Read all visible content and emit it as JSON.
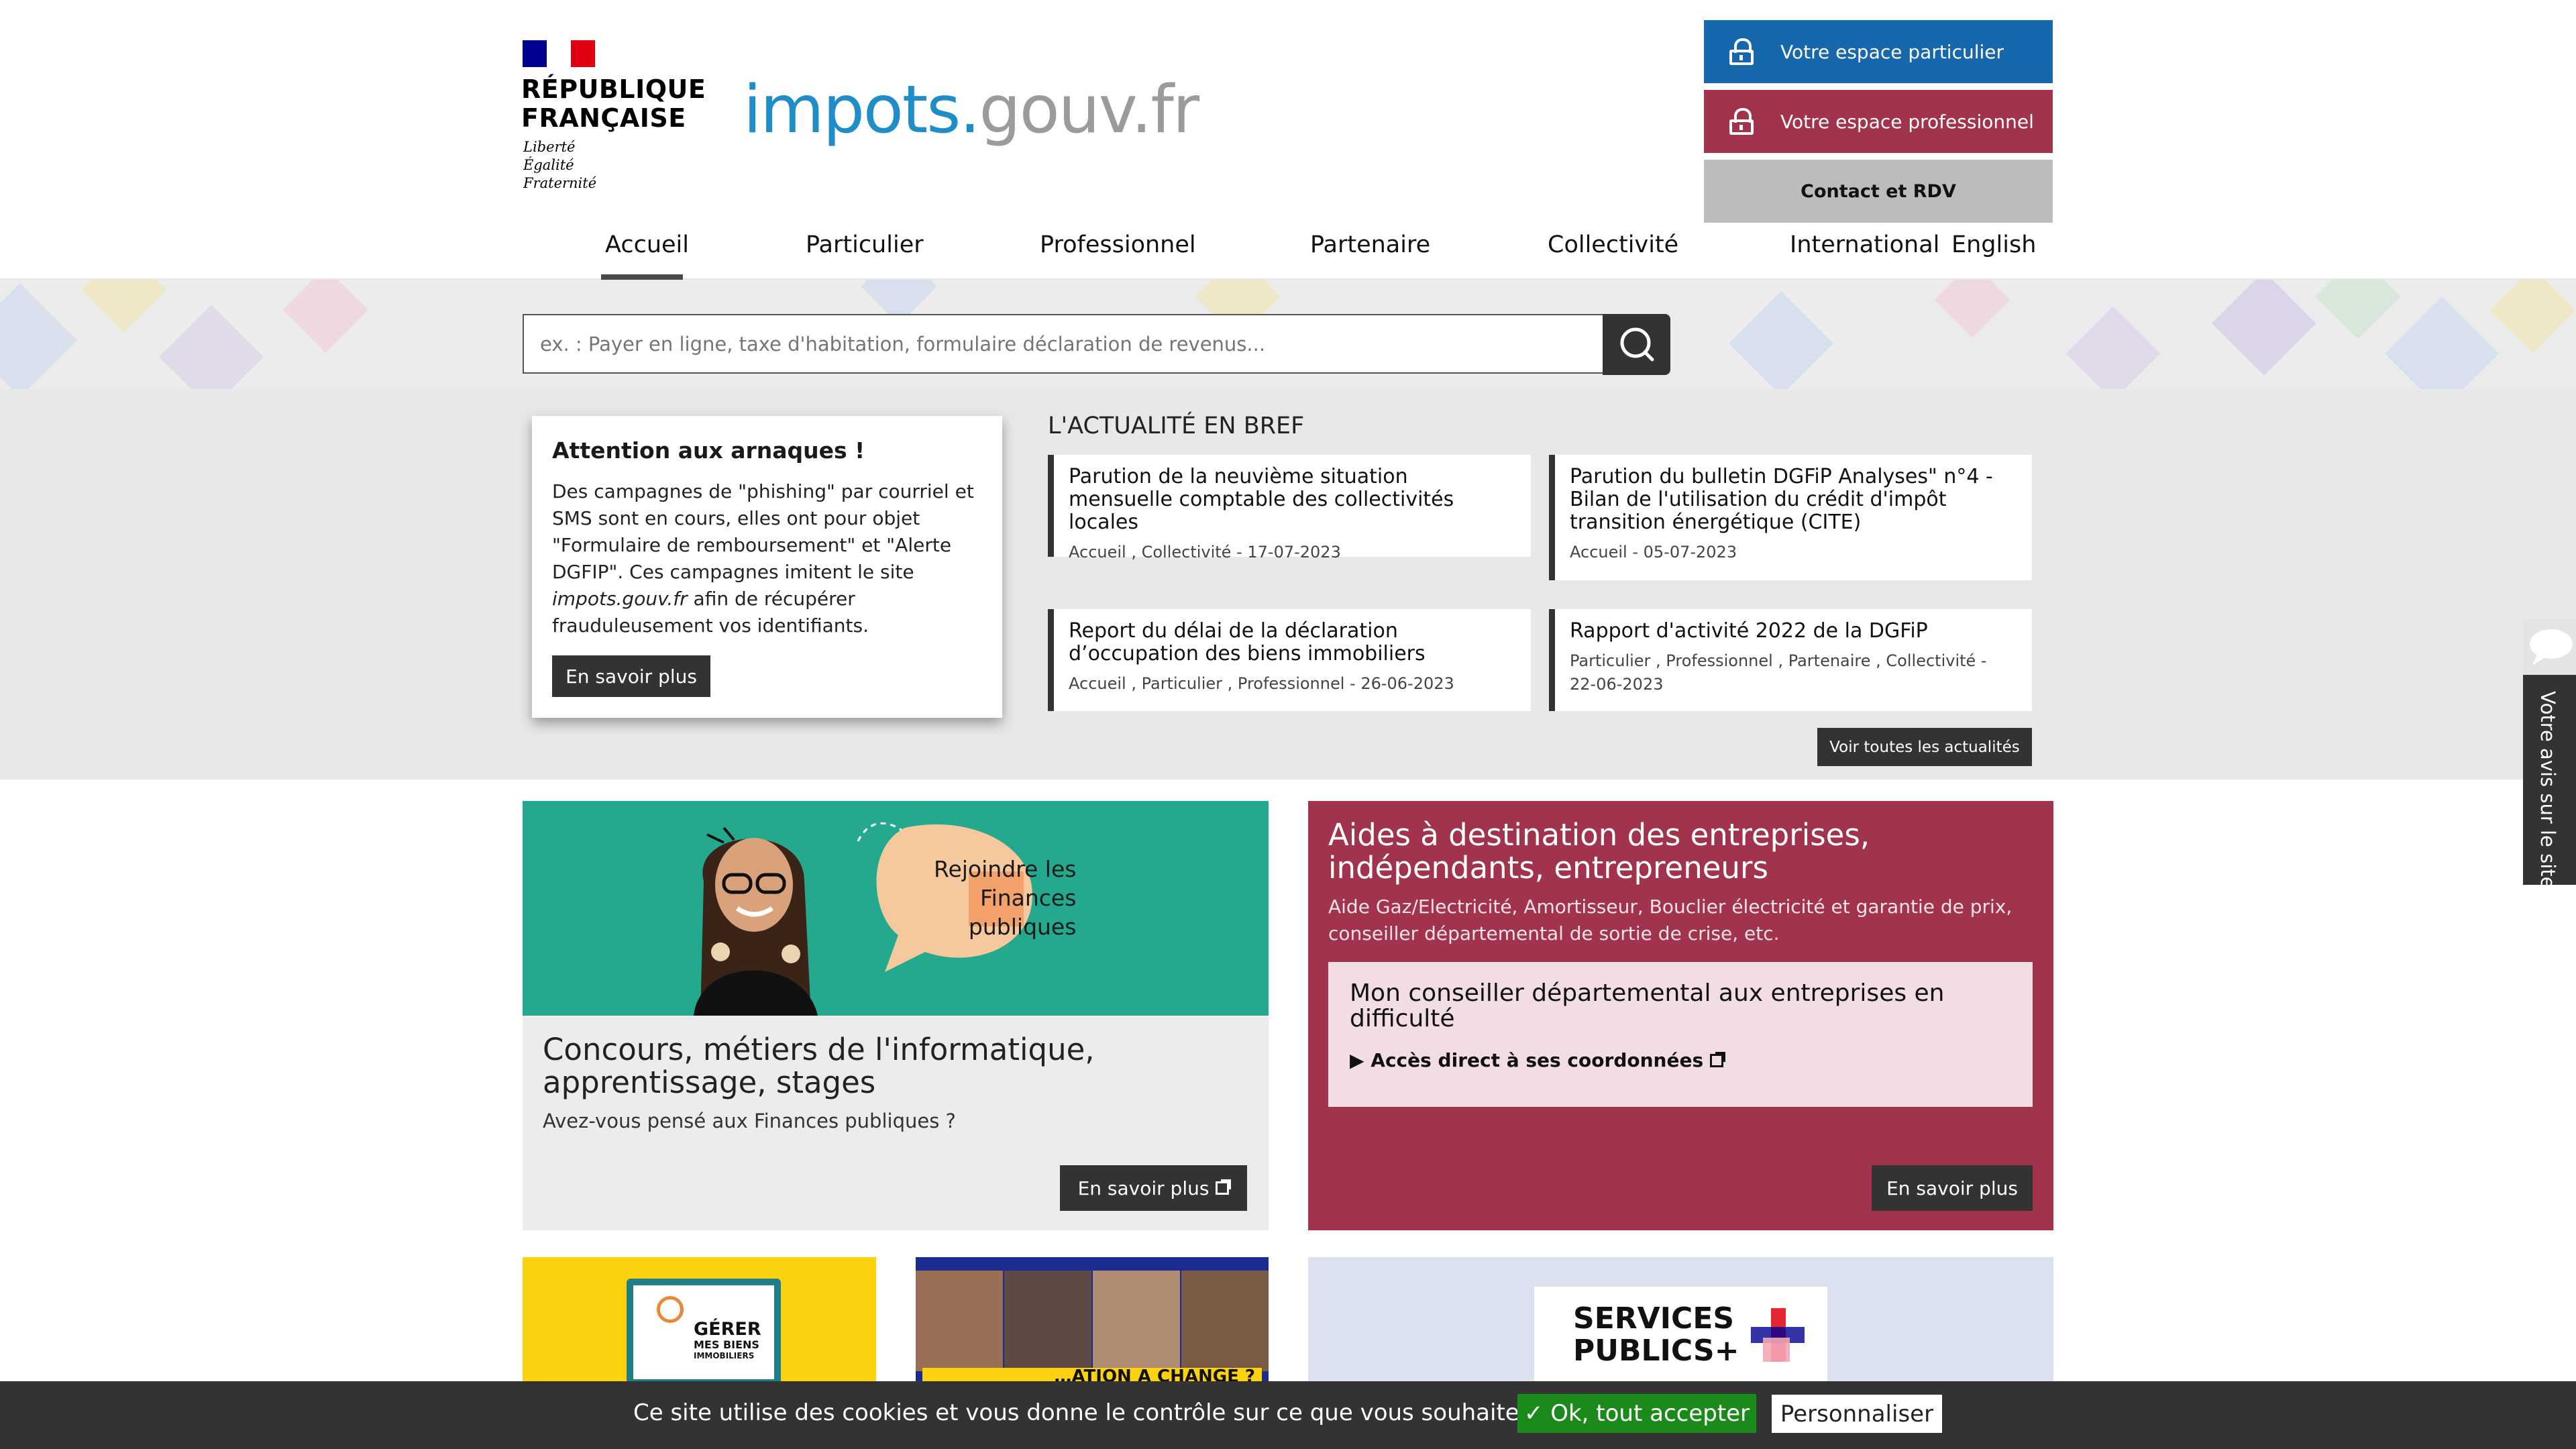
{
  "header": {
    "rf_line1": "RÉPUBLIQUE",
    "rf_line2": "FRANÇAISE",
    "motto1": "Liberté",
    "motto2": "Égalité",
    "motto3": "Fraternité",
    "logo_part1": "impots.",
    "logo_part2": "gouv.fr",
    "btn_particulier": "Votre espace particulier",
    "btn_professionnel": "Votre espace professionnel",
    "btn_contact": "Contact et RDV",
    "colors": {
      "blue": "#1667ac",
      "red": "#a2334c",
      "grey": "#bcbcbc"
    }
  },
  "nav": {
    "items": [
      "Accueil",
      "Particulier",
      "Professionnel",
      "Partenaire",
      "Collectivité",
      "International",
      "English"
    ],
    "active": "Accueil"
  },
  "search": {
    "placeholder": "ex. : Payer en ligne, taxe d'habitation, formulaire déclaration de revenus...",
    "icon": "search-icon"
  },
  "alert": {
    "title": "Attention aux arnaques !",
    "text_before": "Des campagnes de \"phishing\" par courriel et SMS sont en cours, elles ont pour objet \"Formulaire de remboursement\" et \"Alerte DGFIP\". Ces campagnes imitent le site ",
    "text_italic": "impots.gouv.fr",
    "text_after": " afin de récupérer frauduleusement vos identifiants.",
    "button": "En savoir plus"
  },
  "news": {
    "heading": "L'ACTUALITÉ EN BREF",
    "items": [
      {
        "title": "Parution de la neuvième situation mensuelle comptable des collectivités locales",
        "meta": "Accueil , Collectivité - 17-07-2023"
      },
      {
        "title": "Parution du bulletin DGFiP Analyses\" n°4 - Bilan de l'utilisation du crédit d'impôt transition énergétique (CITE)",
        "meta": "Accueil - 05-07-2023"
      },
      {
        "title": "Report du délai de la déclaration d’occupation des biens immobiliers",
        "meta": "Accueil , Particulier , Professionnel - 26-06-2023"
      },
      {
        "title": "Rapport d'activité 2022 de la DGFiP",
        "meta": "Particulier , Professionnel , Partenaire , Collectivité - 22-06-2023"
      }
    ],
    "see_all": "Voir toutes les actualités"
  },
  "card_recruit": {
    "bubble_line1": "Rejoindre les",
    "bubble_line2": "Finances",
    "bubble_line3": "publiques",
    "title": "Concours, métiers de l'informatique, apprentissage, stages",
    "subtitle": "Avez-vous pensé aux Finances publiques ?",
    "button": "En savoir plus"
  },
  "card_aides": {
    "title": "Aides à destination des entreprises, indépendants, entrepreneurs",
    "subtitle": "Aide Gaz/Electricité, Amortisseur, Bouclier électricité et garantie de prix, conseiller départemental de sortie de crise, etc.",
    "inner_title": "Mon conseiller départemental aux entreprises en difficulté",
    "inner_link": "▶ Accès direct à ses coordonnées",
    "button": "En savoir plus"
  },
  "tiles": {
    "gerer_line1": "GÉRER",
    "gerer_line2": "MES BIENS",
    "gerer_line3": "IMMOBILIERS",
    "photo_caption": "…ATION A CHANGÉ ?",
    "services_line1": "SERVICES",
    "services_line2": "PUBLICS+"
  },
  "cookie": {
    "text": "Ce site utilise des cookies et vous donne le contrôle sur ce que vous souhaitez activer",
    "accept": "✓ Ok, tout accepter",
    "customize": "Personnaliser"
  },
  "feedback": {
    "label": "Votre avis sur le site"
  }
}
